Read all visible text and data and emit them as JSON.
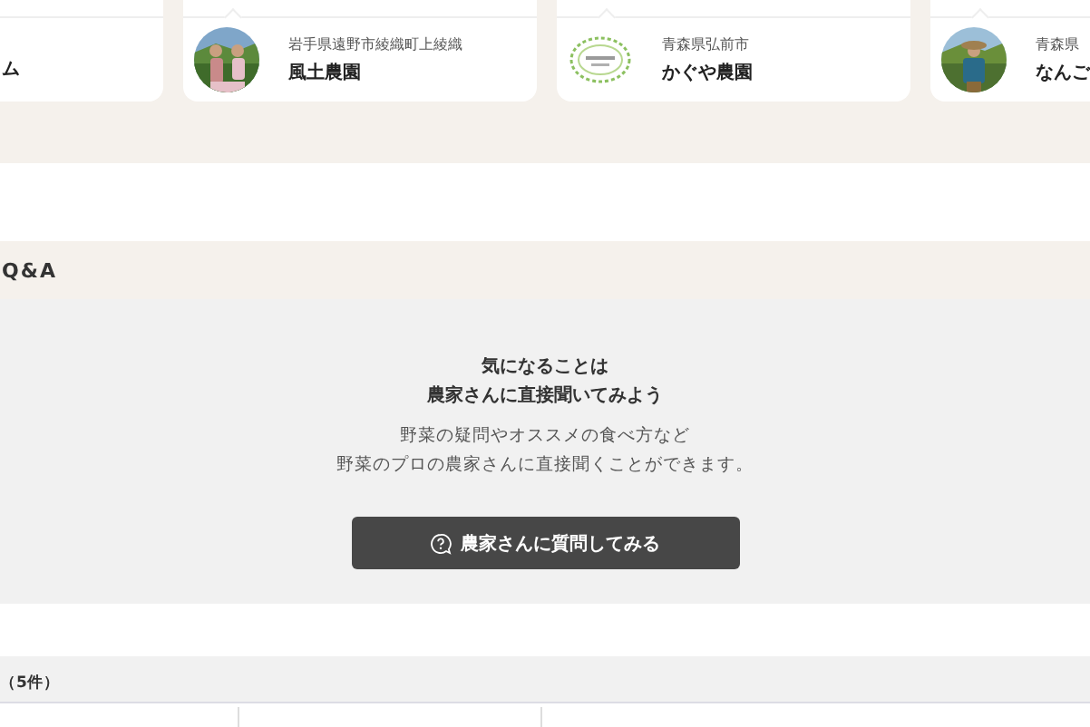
{
  "farms": [
    {
      "kind": "text",
      "name": "ム"
    },
    {
      "kind": "picture",
      "location": "岩手県遠野市綾織町上綾織",
      "name": "風土農園"
    },
    {
      "kind": "logo",
      "location": "青森県弘前市",
      "name": "かぐや農園"
    },
    {
      "kind": "picture",
      "location": "青森県",
      "name": "なんご"
    }
  ],
  "qa": {
    "title": "Q&A",
    "heading": [
      "気になることは",
      "農家さんに直接聞いてみよう"
    ],
    "description": [
      "野菜の疑問やオススメの食べ方など",
      "野菜のプロの農家さんに直接聞くことができます。"
    ],
    "button": "農家さんに質問してみる"
  },
  "list": {
    "count": "（5件）"
  }
}
